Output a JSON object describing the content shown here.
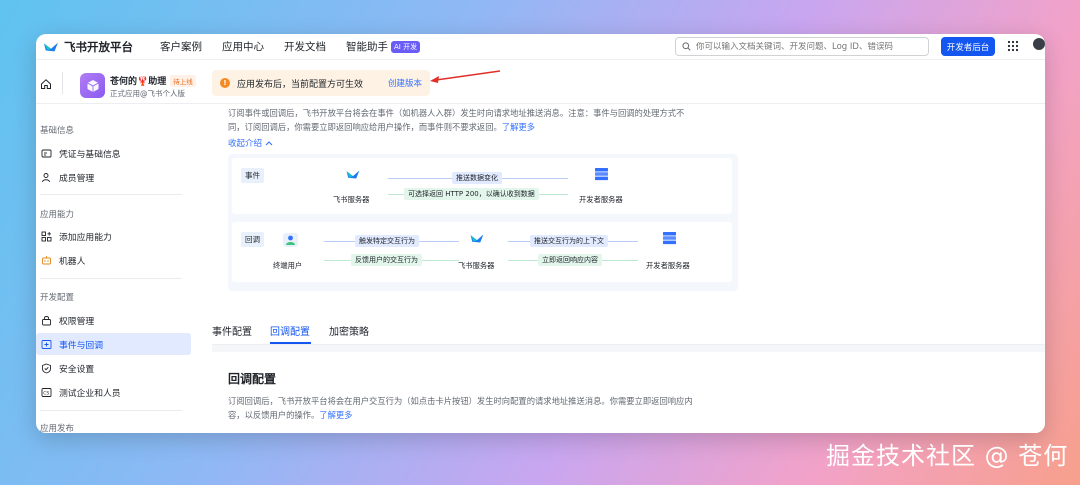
{
  "topnav": {
    "brand": "飞书开放平台",
    "items": [
      "客户案例",
      "应用中心",
      "开发文档",
      "智能助手"
    ],
    "ai_badge": "AI 开发",
    "search_placeholder": "你可以输入文档关键词、开发问题、Log ID、错误码",
    "dev_console": "开发者后台"
  },
  "app": {
    "name": "苍何的🦞助理",
    "status": "待上线",
    "subtitle": "正式应用@飞书个人版"
  },
  "notice": {
    "text": "应用发布后，当前配置方可生效",
    "link": "创建版本"
  },
  "sidebar": {
    "sections": [
      {
        "title": "基础信息",
        "items": [
          "凭证与基础信息",
          "成员管理"
        ]
      },
      {
        "title": "应用能力",
        "items": [
          "添加应用能力",
          "机器人"
        ]
      },
      {
        "title": "开发配置",
        "items": [
          "权限管理",
          "事件与回调",
          "安全设置",
          "测试企业和人员"
        ]
      },
      {
        "title": "应用发布",
        "items": []
      }
    ]
  },
  "intro": {
    "desc_line1": "订阅事件或回调后，飞书开放平台将会在事件（如机器人入群）发生时向请求地址推送消息。注意：事件与回调的处理方式不",
    "desc_line2": "同，订阅回调后，你需要立即返回响应给用户操作，而事件则不要求返回。",
    "more": "了解更多",
    "collapse": "收起介绍"
  },
  "diagram": {
    "event_tag": "事件",
    "callback_tag": "回调",
    "event_push": "推送数据变化",
    "event_return": "可选择返回 HTTP 200，以确认收到数据",
    "feishu_server": "飞书服务器",
    "dev_server": "开发者服务器",
    "end_user": "终端用户",
    "cb_trigger": "触发特定交互行为",
    "cb_feedback": "反馈用户的交互行为",
    "cb_push_ctx": "推送交互行为的上下文",
    "cb_return": "立即返回响应内容"
  },
  "tabs": [
    "事件配置",
    "回调配置",
    "加密策略"
  ],
  "callback": {
    "title": "回调配置",
    "desc_line1": "订阅回调后，飞书开放平台将会在用户交互行为（如点击卡片按钮）发生时向配置的请求地址推送消息。你需要立即返回响应内",
    "desc_line2": "容，以反馈用户的操作。",
    "more": "了解更多"
  },
  "watermark": "掘金技术社区 @ 苍何"
}
